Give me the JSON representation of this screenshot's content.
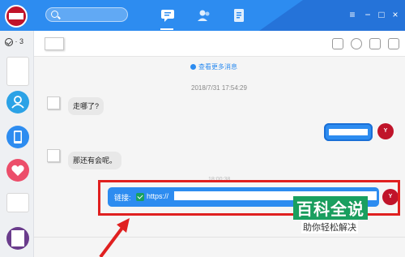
{
  "titlebar": {
    "bg_color": "#2d8cf0",
    "search_icon": "search-icon",
    "tabs": [
      {
        "name": "messages-tab",
        "icon": "chat-icon",
        "active": true
      },
      {
        "name": "contacts-tab",
        "icon": "contacts-icon",
        "active": false
      },
      {
        "name": "files-tab",
        "icon": "document-icon",
        "active": false
      }
    ],
    "window_controls": [
      "menu-icon",
      "minimize-icon",
      "maximize-icon",
      "close-icon"
    ]
  },
  "sidebar": {
    "counter": "· 3"
  },
  "chat": {
    "more_messages": "查看更多消息",
    "timestamp": "2018/7/31 17:54:29",
    "messages": [
      {
        "direction": "in",
        "text": "走哪了?"
      },
      {
        "direction": "out",
        "text": ""
      },
      {
        "direction": "in",
        "text": "那还有会呢。"
      }
    ],
    "hidden_timestamp": "18:00:38",
    "link_message": {
      "label": "链接:",
      "url": "https://"
    },
    "peer_avatar_text": "Y"
  },
  "watermark": {
    "title": "百科全说",
    "subtitle": "助你轻松解决"
  },
  "colors": {
    "accent": "#2d8cf0",
    "highlight_box": "#e02020",
    "watermark": "#1aa060"
  }
}
